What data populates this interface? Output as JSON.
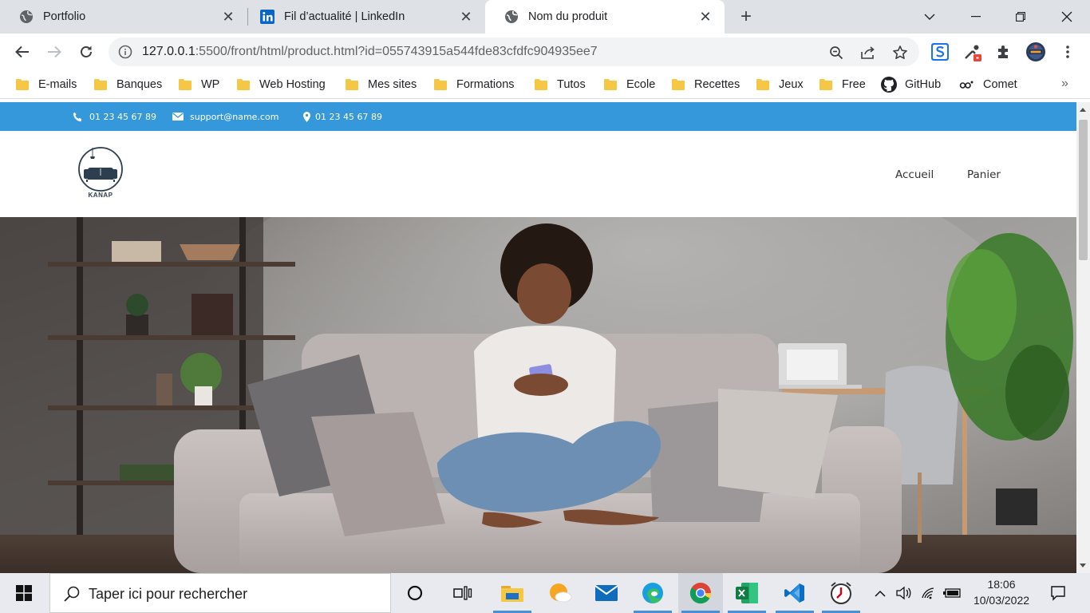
{
  "browser": {
    "tabs": [
      {
        "label": "Portfolio",
        "favicon": "globe-icon",
        "active": false
      },
      {
        "label": "Fil d’actualité | LinkedIn",
        "favicon": "linkedin-icon",
        "active": false
      },
      {
        "label": "Nom du produit",
        "favicon": "globe-icon",
        "active": true
      }
    ],
    "url_host": "127.0.0.1",
    "url_rest": ":5500/front/html/product.html?id=055743915a544fde83cfdfc904935ee7",
    "bookmarks": [
      {
        "label": "E-mails",
        "icon": "folder-icon"
      },
      {
        "label": "Banques",
        "icon": "folder-icon"
      },
      {
        "label": "WP",
        "icon": "folder-icon"
      },
      {
        "label": "Web Hosting",
        "icon": "folder-icon"
      },
      {
        "label": "Mes sites",
        "icon": "folder-icon"
      },
      {
        "label": "Formations",
        "icon": "folder-icon"
      },
      {
        "label": "Tutos",
        "icon": "folder-icon"
      },
      {
        "label": "Ecole",
        "icon": "folder-icon"
      },
      {
        "label": "Recettes",
        "icon": "folder-icon"
      },
      {
        "label": "Jeux",
        "icon": "folder-icon"
      },
      {
        "label": "Free",
        "icon": "folder-icon"
      },
      {
        "label": "GitHub",
        "icon": "github-icon"
      },
      {
        "label": "Comet",
        "icon": "comet-icon"
      }
    ],
    "bookmarks_more": "»"
  },
  "page": {
    "topbar_color": "#3498db",
    "phone": "01 23 45 67 89",
    "email": "support@name.com",
    "address": "01 23 45 67 89",
    "logo_text": "KANAP",
    "nav": [
      {
        "label": "Accueil"
      },
      {
        "label": "Panier"
      }
    ]
  },
  "taskbar": {
    "search_placeholder": "Taper ici pour rechercher",
    "time": "18:06",
    "date": "10/03/2022"
  }
}
